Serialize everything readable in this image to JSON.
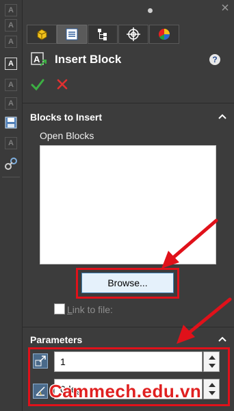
{
  "panel": {
    "title": "Insert Block",
    "help_glyph": "?",
    "ok_icon": "check-icon",
    "cancel_icon": "x-icon"
  },
  "tabs": [
    {
      "icon": "feature-manager-icon"
    },
    {
      "icon": "property-manager-icon"
    },
    {
      "icon": "configuration-manager-icon"
    },
    {
      "icon": "dimxpert-icon"
    },
    {
      "icon": "display-manager-icon"
    }
  ],
  "blocks_section": {
    "title": "Blocks to Insert",
    "open_blocks_label": "Open Blocks",
    "browse_label": "Browse...",
    "link_label_first": "L",
    "link_label_rest": "ink to file:",
    "link_checked": false
  },
  "parameters_section": {
    "title": "Parameters",
    "scale_value": "1",
    "angle_value": "0deg"
  },
  "watermark": "Cammech.edu.vn",
  "colors": {
    "highlight_red": "#e0111a",
    "ok_green": "#3cb043",
    "cancel_red": "#e03030"
  }
}
